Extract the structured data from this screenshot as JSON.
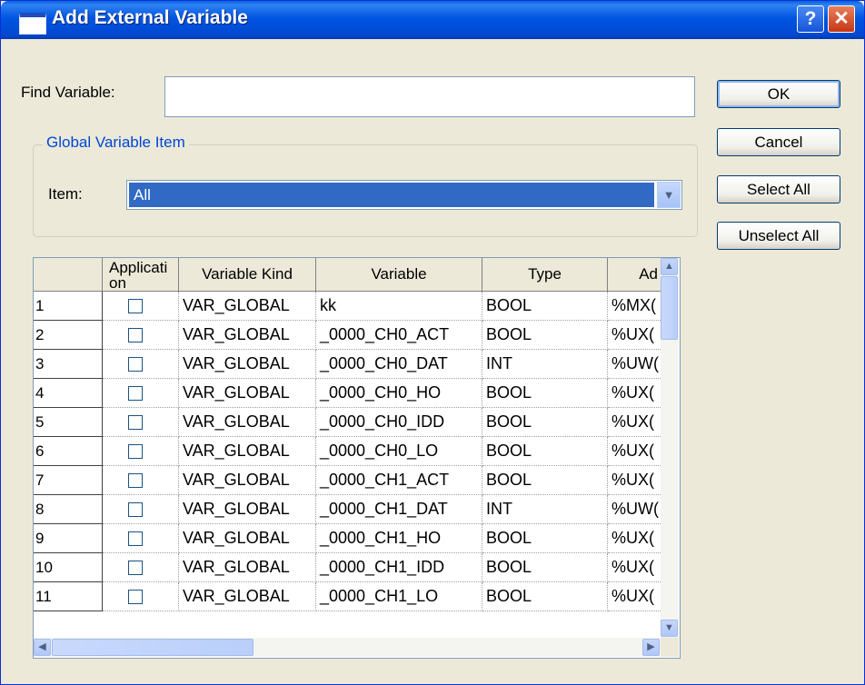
{
  "window": {
    "title": "Add External Variable",
    "help_label": "?",
    "close_label": "✕"
  },
  "find": {
    "label": "Find Variable:",
    "value": ""
  },
  "buttons": {
    "ok": "OK",
    "cancel": "Cancel",
    "select_all": "Select All",
    "unselect_all": "Unselect All"
  },
  "group": {
    "caption": "Global Variable Item",
    "item_label": "Item:",
    "item_value": "All"
  },
  "grid": {
    "headers": [
      "",
      "Applicati\non",
      "Variable Kind",
      "Variable",
      "Type",
      "Ad"
    ],
    "rows": [
      {
        "num": "1",
        "checked": false,
        "kind": "VAR_GLOBAL",
        "variable": "kk",
        "type": "BOOL",
        "address": "%MX("
      },
      {
        "num": "2",
        "checked": false,
        "kind": "VAR_GLOBAL",
        "variable": "_0000_CH0_ACT",
        "type": "BOOL",
        "address": "%UX("
      },
      {
        "num": "3",
        "checked": false,
        "kind": "VAR_GLOBAL",
        "variable": "_0000_CH0_DAT",
        "type": "INT",
        "address": "%UW("
      },
      {
        "num": "4",
        "checked": false,
        "kind": "VAR_GLOBAL",
        "variable": "_0000_CH0_HO",
        "type": "BOOL",
        "address": "%UX("
      },
      {
        "num": "5",
        "checked": false,
        "kind": "VAR_GLOBAL",
        "variable": "_0000_CH0_IDD",
        "type": "BOOL",
        "address": "%UX("
      },
      {
        "num": "6",
        "checked": false,
        "kind": "VAR_GLOBAL",
        "variable": "_0000_CH0_LO",
        "type": "BOOL",
        "address": "%UX("
      },
      {
        "num": "7",
        "checked": false,
        "kind": "VAR_GLOBAL",
        "variable": "_0000_CH1_ACT",
        "type": "BOOL",
        "address": "%UX("
      },
      {
        "num": "8",
        "checked": false,
        "kind": "VAR_GLOBAL",
        "variable": "_0000_CH1_DAT",
        "type": "INT",
        "address": "%UW("
      },
      {
        "num": "9",
        "checked": false,
        "kind": "VAR_GLOBAL",
        "variable": "_0000_CH1_HO",
        "type": "BOOL",
        "address": "%UX("
      },
      {
        "num": "10",
        "checked": false,
        "kind": "VAR_GLOBAL",
        "variable": "_0000_CH1_IDD",
        "type": "BOOL",
        "address": "%UX("
      },
      {
        "num": "11",
        "checked": false,
        "kind": "VAR_GLOBAL",
        "variable": "_0000_CH1_LO",
        "type": "BOOL",
        "address": "%UX("
      }
    ]
  },
  "colors": {
    "title_bar": "#0054e3",
    "selection": "#316ac5",
    "group_caption": "#0046d5"
  },
  "icons": {
    "title": "window-icon",
    "help": "help-icon",
    "close": "close-icon",
    "dropdown": "chevron-down-icon"
  }
}
